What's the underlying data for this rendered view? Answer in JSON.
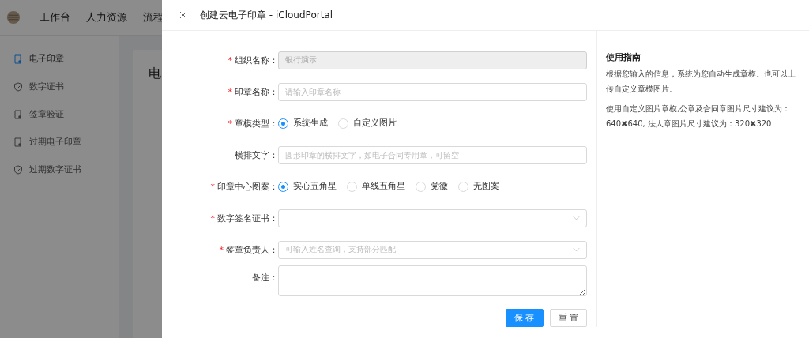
{
  "top_nav": {
    "items": [
      "工作台",
      "人力资源",
      "流程"
    ]
  },
  "sidebar": {
    "items": [
      {
        "label": "电子印章",
        "kind": "document",
        "selected": true
      },
      {
        "label": "数字证书",
        "kind": "shield",
        "selected": false
      },
      {
        "label": "签章验证",
        "kind": "document",
        "selected": false
      },
      {
        "label": "过期电子印章",
        "kind": "document",
        "selected": false
      },
      {
        "label": "过期数字证书",
        "kind": "shield",
        "selected": false
      }
    ]
  },
  "content": {
    "title": "电"
  },
  "drawer": {
    "title": "创建云电子印章 - iCloudPortal",
    "fields": [
      {
        "label": "组织名称：",
        "required_mark": "*",
        "kind": "input",
        "disabled": true,
        "value": "银行演示"
      },
      {
        "label": "印章名称：",
        "required_mark": "*",
        "kind": "input",
        "disabled": false,
        "placeholder": "请输入印章名称"
      },
      {
        "label": "章模类型：",
        "required_mark": "*",
        "kind": "radio",
        "options": [
          {
            "label": "系统生成",
            "selected": true
          },
          {
            "label": "自定义图片",
            "selected": false
          }
        ]
      },
      {
        "label": "横排文字：",
        "kind": "input",
        "disabled": false,
        "placeholder": "圆形印章的横排文字，如电子合同专用章，可留空"
      },
      {
        "label": "印章中心图案：",
        "required_mark": "*",
        "kind": "radio",
        "options": [
          {
            "label": "实心五角星",
            "selected": true
          },
          {
            "label": "单线五角星",
            "selected": false
          },
          {
            "label": "党徽",
            "selected": false
          },
          {
            "label": "无图案",
            "selected": false
          }
        ]
      },
      {
        "label": "数字签名证书：",
        "required_mark": "*",
        "kind": "select"
      },
      {
        "label": "签章负责人：",
        "required_mark": "*",
        "kind": "select",
        "placeholder": "可输入姓名查询，支持部分匹配"
      },
      {
        "label": "备注：",
        "kind": "textarea"
      }
    ],
    "buttons": [
      {
        "label": "保 存",
        "kind": "primary"
      },
      {
        "label": "重 置",
        "kind": "default"
      }
    ],
    "guide": {
      "title": "使用指南",
      "paragraphs": [
        "根据您输入的信息，系统为您自动生成章模。也可以上传自定义章模图片。",
        "使用自定义图片章模,公章及合同章图片尺寸建议为：640✖640, 法人章图片尺寸建议为：320✖320"
      ]
    }
  }
}
